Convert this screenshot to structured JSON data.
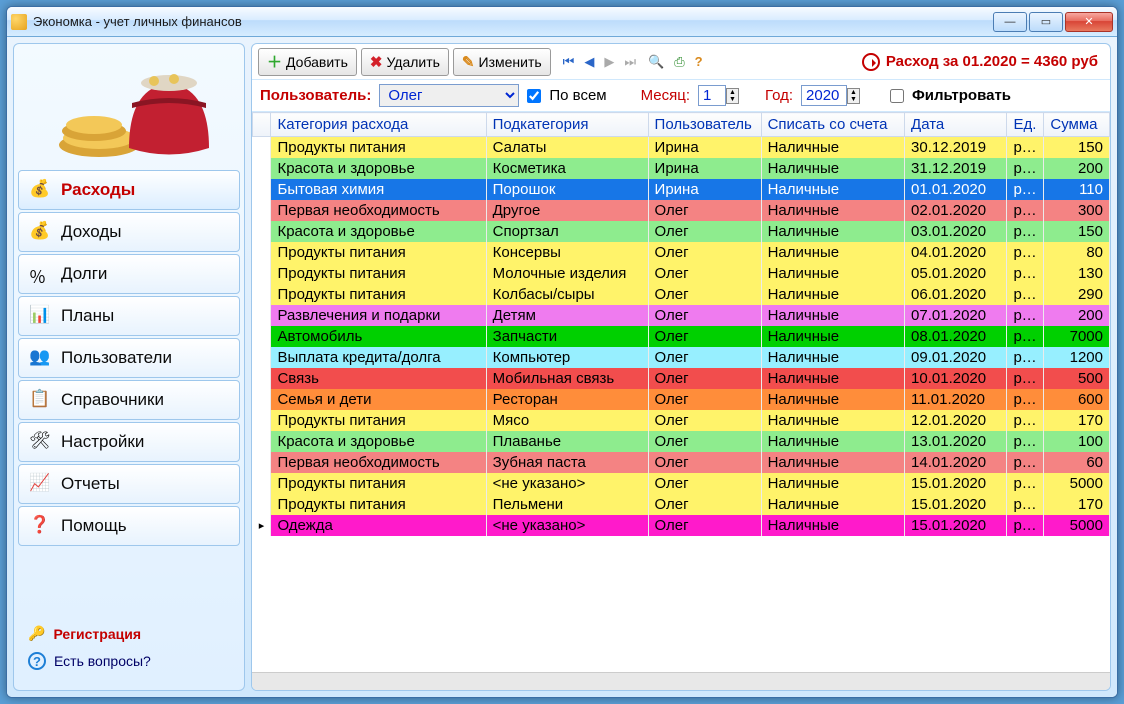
{
  "window": {
    "title": "Экономка - учет личных финансов"
  },
  "sidebar": {
    "items": [
      {
        "label": "Расходы"
      },
      {
        "label": "Доходы"
      },
      {
        "label": "Долги"
      },
      {
        "label": "Планы"
      },
      {
        "label": "Пользователи"
      },
      {
        "label": "Справочники"
      },
      {
        "label": "Настройки"
      },
      {
        "label": "Отчеты"
      },
      {
        "label": "Помощь"
      }
    ],
    "register": "Регистрация",
    "question": "Есть вопросы?"
  },
  "toolbar": {
    "add": "Добавить",
    "del": "Удалить",
    "edit": "Изменить",
    "status_prefix": "Расход за 01.2020 = ",
    "status_value": "4360 руб"
  },
  "filter": {
    "user_lbl": "Пользователь:",
    "user_value": "Олег",
    "all": "По всем",
    "month_lbl": "Месяц:",
    "month": "1",
    "year_lbl": "Год:",
    "year": "2020",
    "filter_lbl": "Фильтровать"
  },
  "grid": {
    "cols": [
      "Категория расхода",
      "Подкатегория",
      "Пользователь",
      "Списать со счета",
      "Дата",
      "Ед.",
      "Сумма"
    ],
    "rows": [
      {
        "c": "yellow",
        "cat": "Продукты питания",
        "sub": "Салаты",
        "user": "Ирина",
        "acct": "Наличные",
        "date": "30.12.2019",
        "unit": "руб",
        "sum": "150"
      },
      {
        "c": "lime",
        "cat": "Красота и здоровье",
        "sub": "Косметика",
        "user": "Ирина",
        "acct": "Наличные",
        "date": "31.12.2019",
        "unit": "руб",
        "sum": "200"
      },
      {
        "c": "blue",
        "cat": "Бытовая химия",
        "sub": "Порошок",
        "user": "Ирина",
        "acct": "Наличные",
        "date": "01.01.2020",
        "unit": "руб",
        "sum": "110"
      },
      {
        "c": "salmon",
        "cat": "Первая необходимость",
        "sub": "Другое",
        "user": "Олег",
        "acct": "Наличные",
        "date": "02.01.2020",
        "unit": "руб",
        "sum": "300"
      },
      {
        "c": "lime",
        "cat": "Красота и здоровье",
        "sub": "Спортзал",
        "user": "Олег",
        "acct": "Наличные",
        "date": "03.01.2020",
        "unit": "руб",
        "sum": "150"
      },
      {
        "c": "yellow",
        "cat": "Продукты питания",
        "sub": "Консервы",
        "user": "Олег",
        "acct": "Наличные",
        "date": "04.01.2020",
        "unit": "руб",
        "sum": "80"
      },
      {
        "c": "yellow",
        "cat": "Продукты питания",
        "sub": "Молочные изделия",
        "user": "Олег",
        "acct": "Наличные",
        "date": "05.01.2020",
        "unit": "руб",
        "sum": "130"
      },
      {
        "c": "yellow",
        "cat": "Продукты питания",
        "sub": "Колбасы/сыры",
        "user": "Олег",
        "acct": "Наличные",
        "date": "06.01.2020",
        "unit": "руб",
        "sum": "290"
      },
      {
        "c": "pinkv",
        "cat": "Развлечения и подарки",
        "sub": "Детям",
        "user": "Олег",
        "acct": "Наличные",
        "date": "07.01.2020",
        "unit": "руб",
        "sum": "200"
      },
      {
        "c": "green",
        "cat": "Автомобиль",
        "sub": "Запчасти",
        "user": "Олег",
        "acct": "Наличные",
        "date": "08.01.2020",
        "unit": "руб",
        "sum": "7000"
      },
      {
        "c": "cyan",
        "cat": "Выплата кредита/долга",
        "sub": "Компьютер",
        "user": "Олег",
        "acct": "Наличные",
        "date": "09.01.2020",
        "unit": "руб",
        "sum": "1200"
      },
      {
        "c": "red",
        "cat": "Связь",
        "sub": "Мобильная связь",
        "user": "Олег",
        "acct": "Наличные",
        "date": "10.01.2020",
        "unit": "руб",
        "sum": "500"
      },
      {
        "c": "orange",
        "cat": "Семья и дети",
        "sub": "Ресторан",
        "user": "Олег",
        "acct": "Наличные",
        "date": "11.01.2020",
        "unit": "руб",
        "sum": "600"
      },
      {
        "c": "yellow",
        "cat": "Продукты питания",
        "sub": "Мясо",
        "user": "Олег",
        "acct": "Наличные",
        "date": "12.01.2020",
        "unit": "руб",
        "sum": "170"
      },
      {
        "c": "lime",
        "cat": "Красота и здоровье",
        "sub": "Плаванье",
        "user": "Олег",
        "acct": "Наличные",
        "date": "13.01.2020",
        "unit": "руб",
        "sum": "100"
      },
      {
        "c": "salmon",
        "cat": "Первая необходимость",
        "sub": "Зубная паста",
        "user": "Олег",
        "acct": "Наличные",
        "date": "14.01.2020",
        "unit": "руб",
        "sum": "60"
      },
      {
        "c": "yellow",
        "cat": "Продукты питания",
        "sub": "<не указано>",
        "user": "Олег",
        "acct": "Наличные",
        "date": "15.01.2020",
        "unit": "руб",
        "sum": "5000"
      },
      {
        "c": "yellow",
        "cat": "Продукты питания",
        "sub": "Пельмени",
        "user": "Олег",
        "acct": "Наличные",
        "date": "15.01.2020",
        "unit": "руб",
        "sum": "170"
      },
      {
        "c": "magenta",
        "cat": "Одежда",
        "sub": "<не указано>",
        "user": "Олег",
        "acct": "Наличные",
        "date": "15.01.2020",
        "unit": "руб",
        "sum": "5000",
        "cur": true
      }
    ]
  }
}
